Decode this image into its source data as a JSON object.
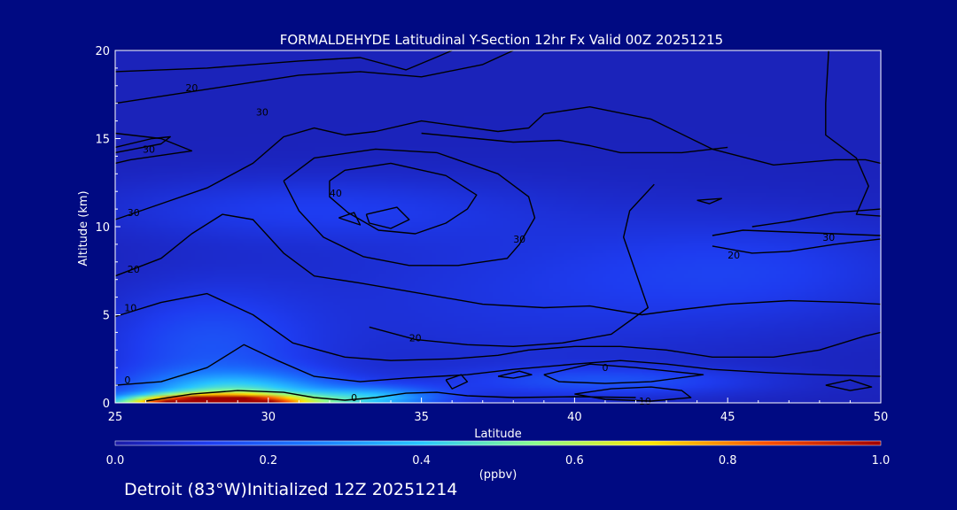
{
  "chart_data": {
    "type": "heatmap",
    "title": "FORMALDEHYDE Latitudinal Y-Section 12hr  Fx Valid 00Z 20251215",
    "xlabel": "Latitude",
    "ylabel": "Altitude (km)",
    "xlim": [
      25,
      50
    ],
    "ylim": [
      0,
      20
    ],
    "x_ticks": [
      "25",
      "30",
      "35",
      "40",
      "45",
      "50"
    ],
    "y_ticks": [
      "0",
      "5",
      "10",
      "15",
      "20"
    ],
    "colorbar": {
      "min": 0.0,
      "max": 1.0,
      "unit": "(ppbv)",
      "ticks": [
        "0.0",
        "0.2",
        "0.4",
        "0.6",
        "0.8",
        "1.0"
      ]
    },
    "color_stops": [
      [
        0.0,
        "#1a1aa8"
      ],
      [
        0.12,
        "#1e3cf0"
      ],
      [
        0.25,
        "#1a78ff"
      ],
      [
        0.4,
        "#28c8ff"
      ],
      [
        0.55,
        "#8cff8c"
      ],
      [
        0.7,
        "#ffe600"
      ],
      [
        0.85,
        "#ff5000"
      ],
      [
        1.0,
        "#a00000"
      ]
    ],
    "field_blobs": [
      {
        "lat": 28.2,
        "alt": 0.0,
        "slat": 3.0,
        "salt": 0.45,
        "amp": 1.0
      },
      {
        "lat": 29.0,
        "alt": 0.6,
        "slat": 3.2,
        "salt": 1.1,
        "amp": 0.35
      },
      {
        "lat": 33.5,
        "alt": 0.3,
        "slat": 2.2,
        "salt": 0.6,
        "amp": 0.3
      },
      {
        "lat": 28.0,
        "alt": 3.0,
        "slat": 3.5,
        "salt": 3.5,
        "amp": 0.13
      },
      {
        "lat": 31.0,
        "alt": 11.0,
        "slat": 7.0,
        "salt": 1.8,
        "amp": 0.08
      },
      {
        "lat": 41.0,
        "alt": 1.2,
        "slat": 5.0,
        "salt": 0.8,
        "amp": 0.12
      },
      {
        "lat": 46.0,
        "alt": 7.5,
        "slat": 6.0,
        "salt": 3.0,
        "amp": 0.08
      },
      {
        "lat": 38.0,
        "alt": 6.0,
        "slat": 8.0,
        "salt": 5.0,
        "amp": 0.06
      }
    ],
    "contours": [
      {
        "label": "20",
        "label_at": [
          27.5,
          17.9
        ],
        "points": [
          [
            25,
            17.0
          ],
          [
            28,
            17.8
          ],
          [
            31,
            18.6
          ],
          [
            33,
            18.8
          ],
          [
            35,
            18.5
          ],
          [
            37,
            19.2
          ],
          [
            38,
            20
          ]
        ]
      },
      {
        "label": "",
        "label_at": null,
        "points": [
          [
            25,
            18.8
          ],
          [
            28,
            19.0
          ],
          [
            31,
            19.4
          ],
          [
            33,
            19.6
          ],
          [
            34.5,
            18.9
          ],
          [
            35.6,
            19.7
          ],
          [
            36,
            20
          ]
        ]
      },
      {
        "label": "30",
        "label_at": [
          26.1,
          14.4
        ],
        "points": [
          [
            25,
            15.3
          ],
          [
            26.5,
            15.0
          ],
          [
            27.5,
            14.3
          ],
          [
            25.5,
            13.8
          ],
          [
            25,
            13.6
          ]
        ]
      },
      {
        "label": "",
        "label_at": null,
        "points": [
          [
            25,
            14.5
          ],
          [
            26.2,
            15.0
          ],
          [
            26.8,
            15.1
          ],
          [
            26.5,
            14.7
          ],
          [
            25,
            14.2
          ]
        ]
      },
      {
        "label": "30",
        "label_at": [
          25.6,
          10.8
        ],
        "points": [
          [
            25,
            10.4
          ],
          [
            26.5,
            11.3
          ],
          [
            28,
            12.2
          ],
          [
            29.5,
            13.6
          ],
          [
            30.5,
            15.1
          ],
          [
            31.5,
            15.6
          ],
          [
            32.5,
            15.2
          ],
          [
            33.5,
            15.4
          ],
          [
            35,
            16.0
          ],
          [
            37.5,
            15.4
          ],
          [
            38.5,
            15.6
          ],
          [
            39,
            16.4
          ],
          [
            40.5,
            16.8
          ],
          [
            42.5,
            16.1
          ],
          [
            44.5,
            14.4
          ],
          [
            46.5,
            13.5
          ],
          [
            48.5,
            13.8
          ],
          [
            49.5,
            13.8
          ],
          [
            50,
            13.6
          ]
        ]
      },
      {
        "label": "20",
        "label_at": [
          25.6,
          7.6
        ],
        "points": [
          [
            25,
            7.2
          ],
          [
            26.5,
            8.2
          ],
          [
            27.5,
            9.6
          ],
          [
            28.5,
            10.7
          ],
          [
            29.5,
            10.4
          ],
          [
            30.5,
            8.5
          ],
          [
            31.5,
            7.2
          ],
          [
            33,
            6.8
          ],
          [
            35,
            6.2
          ],
          [
            37,
            5.6
          ],
          [
            39,
            5.4
          ],
          [
            40.5,
            5.5
          ],
          [
            42.2,
            5.0
          ],
          [
            43.5,
            5.3
          ],
          [
            45,
            5.6
          ],
          [
            47,
            5.8
          ],
          [
            49,
            5.7
          ],
          [
            50,
            5.6
          ]
        ]
      },
      {
        "label": "10",
        "label_at": [
          25.5,
          5.4
        ],
        "points": [
          [
            25,
            4.9
          ],
          [
            26.5,
            5.7
          ],
          [
            28,
            6.2
          ],
          [
            29.5,
            5.0
          ],
          [
            30.8,
            3.4
          ],
          [
            32.5,
            2.6
          ],
          [
            34,
            2.4
          ],
          [
            36,
            2.5
          ],
          [
            37.5,
            2.7
          ],
          [
            38.5,
            3.0
          ],
          [
            40,
            3.2
          ],
          [
            41.5,
            3.2
          ],
          [
            43,
            3.0
          ],
          [
            44.5,
            2.6
          ],
          [
            46.5,
            2.6
          ],
          [
            48,
            3.0
          ],
          [
            49.5,
            3.8
          ],
          [
            50,
            4.0
          ]
        ]
      },
      {
        "label": "0",
        "label_at": [
          25.4,
          1.3
        ],
        "points": [
          [
            25,
            1.0
          ],
          [
            26.5,
            1.2
          ],
          [
            28,
            2.0
          ],
          [
            29.2,
            3.3
          ],
          [
            30.3,
            2.4
          ],
          [
            31.5,
            1.5
          ],
          [
            33,
            1.2
          ],
          [
            34.5,
            1.4
          ],
          [
            36.5,
            1.6
          ],
          [
            38,
            1.9
          ],
          [
            40,
            2.2
          ],
          [
            41.5,
            2.4
          ],
          [
            43,
            2.2
          ],
          [
            44.5,
            1.9
          ],
          [
            46.5,
            1.7
          ],
          [
            48,
            1.6
          ],
          [
            50,
            1.5
          ]
        ]
      },
      {
        "label": "0",
        "label_at": [
          32.8,
          0.3
        ],
        "points": [
          [
            26,
            0.1
          ],
          [
            27.5,
            0.5
          ],
          [
            29,
            0.7
          ],
          [
            30.5,
            0.6
          ],
          [
            31.5,
            0.3
          ],
          [
            32.5,
            0.15
          ],
          [
            33.5,
            0.3
          ],
          [
            34.5,
            0.55
          ],
          [
            35.5,
            0.6
          ],
          [
            36.5,
            0.4
          ],
          [
            38,
            0.3
          ],
          [
            40,
            0.35
          ],
          [
            42,
            0.3
          ]
        ]
      },
      {
        "label": "10",
        "label_at": [
          42.3,
          0.1
        ],
        "points": [
          [
            40,
            0.5
          ],
          [
            41.2,
            0.8
          ],
          [
            42.5,
            0.9
          ],
          [
            43.5,
            0.7
          ],
          [
            43.8,
            0.3
          ],
          [
            42.5,
            0.1
          ],
          [
            41,
            0.2
          ],
          [
            40,
            0.5
          ]
        ]
      },
      {
        "label": "0",
        "label_at": [
          41.0,
          2.0
        ],
        "points": [
          [
            39,
            1.6
          ],
          [
            40.5,
            2.2
          ],
          [
            42,
            2.0
          ],
          [
            44.2,
            1.6
          ],
          [
            42.5,
            1.2
          ],
          [
            41,
            1.1
          ],
          [
            39.5,
            1.2
          ],
          [
            39,
            1.6
          ]
        ]
      },
      {
        "label": "",
        "label_at": null,
        "points": [
          [
            37.5,
            1.5
          ],
          [
            38.2,
            1.8
          ],
          [
            38.6,
            1.6
          ],
          [
            38.0,
            1.4
          ],
          [
            37.5,
            1.5
          ]
        ]
      },
      {
        "label": "",
        "label_at": null,
        "points": [
          [
            35.8,
            1.3
          ],
          [
            36.3,
            1.6
          ],
          [
            36.5,
            1.2
          ],
          [
            36.0,
            0.8
          ],
          [
            35.8,
            1.3
          ]
        ]
      },
      {
        "label": "",
        "label_at": null,
        "points": [
          [
            48.2,
            1.0
          ],
          [
            49,
            1.3
          ],
          [
            49.7,
            0.9
          ],
          [
            49,
            0.7
          ],
          [
            48.2,
            1.0
          ]
        ]
      },
      {
        "label": "40",
        "label_at": [
          32.2,
          11.9
        ],
        "points": [
          [
            32,
            12.6
          ],
          [
            32.5,
            13.2
          ],
          [
            34,
            13.6
          ],
          [
            35.8,
            12.9
          ],
          [
            36.8,
            11.8
          ],
          [
            36.5,
            11.0
          ],
          [
            35.8,
            10.2
          ],
          [
            34.8,
            9.6
          ],
          [
            33.6,
            9.8
          ],
          [
            32.6,
            10.8
          ],
          [
            32,
            11.7
          ],
          [
            32,
            12.6
          ]
        ]
      },
      {
        "label": "",
        "label_at": null,
        "points": [
          [
            33.2,
            10.7
          ],
          [
            34.2,
            11.1
          ],
          [
            34.6,
            10.4
          ],
          [
            34.0,
            9.9
          ],
          [
            33.3,
            10.2
          ],
          [
            33.2,
            10.7
          ]
        ]
      },
      {
        "label": "30",
        "label_at": [
          38.2,
          9.3
        ],
        "points": [
          [
            30.5,
            12.6
          ],
          [
            31.5,
            13.9
          ],
          [
            33.5,
            14.4
          ],
          [
            35.5,
            14.2
          ],
          [
            37.5,
            13.0
          ],
          [
            38.5,
            11.7
          ],
          [
            38.7,
            10.5
          ],
          [
            38.2,
            9.0
          ],
          [
            37.8,
            8.2
          ],
          [
            36.2,
            7.8
          ],
          [
            34.6,
            7.8
          ],
          [
            33.1,
            8.3
          ],
          [
            31.8,
            9.4
          ],
          [
            31.0,
            10.9
          ],
          [
            30.5,
            12.6
          ]
        ]
      },
      {
        "label": "30",
        "label_at": [
          29.8,
          16.5
        ],
        "points": [
          [
            35,
            15.3
          ],
          [
            36.8,
            15.0
          ],
          [
            38,
            14.8
          ],
          [
            39.5,
            14.9
          ],
          [
            40.5,
            14.6
          ],
          [
            41.5,
            14.2
          ],
          [
            43.5,
            14.2
          ],
          [
            45,
            14.5
          ]
        ]
      },
      {
        "label": "20",
        "label_at": [
          34.8,
          3.7
        ],
        "points": [
          [
            33.3,
            4.3
          ],
          [
            34.8,
            3.6
          ],
          [
            36.5,
            3.3
          ],
          [
            38,
            3.2
          ],
          [
            39.6,
            3.4
          ],
          [
            41.2,
            3.9
          ],
          [
            42.4,
            5.4
          ],
          [
            42.0,
            7.4
          ],
          [
            41.6,
            9.4
          ],
          [
            41.8,
            10.9
          ],
          [
            42.6,
            12.4
          ]
        ]
      },
      {
        "label": "30",
        "label_at": [
          48.3,
          9.4
        ],
        "points": [
          [
            44.5,
            9.5
          ],
          [
            45.5,
            9.8
          ],
          [
            47,
            9.7
          ],
          [
            48.5,
            9.6
          ],
          [
            50,
            9.5
          ]
        ]
      },
      {
        "label": "20",
        "label_at": [
          45.2,
          8.4
        ],
        "points": [
          [
            44.5,
            8.9
          ],
          [
            45.8,
            8.5
          ],
          [
            47,
            8.6
          ],
          [
            48.5,
            9.0
          ],
          [
            50,
            9.3
          ]
        ]
      },
      {
        "label": "",
        "label_at": null,
        "points": [
          [
            45.8,
            10.0
          ],
          [
            47,
            10.3
          ],
          [
            48.5,
            10.8
          ],
          [
            50,
            11.0
          ]
        ]
      },
      {
        "label": "",
        "label_at": null,
        "points": [
          [
            48.3,
            20
          ],
          [
            48.2,
            17.0
          ],
          [
            48.2,
            15.2
          ],
          [
            49.2,
            13.9
          ],
          [
            49.6,
            12.3
          ],
          [
            49.2,
            10.7
          ],
          [
            50,
            10.6
          ]
        ]
      },
      {
        "label": "",
        "label_at": null,
        "points": [
          [
            44,
            11.5
          ],
          [
            44.8,
            11.6
          ],
          [
            44.4,
            11.3
          ],
          [
            44,
            11.5
          ]
        ]
      },
      {
        "label": "",
        "label_at": null,
        "points": [
          [
            32.3,
            10.5
          ],
          [
            32.8,
            10.8
          ],
          [
            33.0,
            10.1
          ],
          [
            32.3,
            10.5
          ]
        ]
      }
    ]
  },
  "footer": "Detroit (83°W)Initialized 12Z 20251214"
}
